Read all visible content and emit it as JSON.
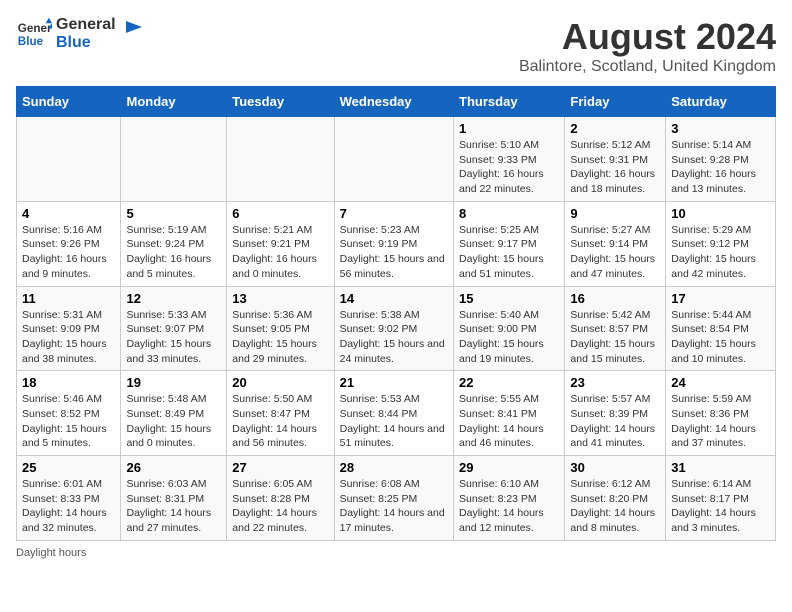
{
  "header": {
    "logo_line1": "General",
    "logo_line2": "Blue",
    "title": "August 2024",
    "subtitle": "Balintore, Scotland, United Kingdom"
  },
  "days_of_week": [
    "Sunday",
    "Monday",
    "Tuesday",
    "Wednesday",
    "Thursday",
    "Friday",
    "Saturday"
  ],
  "weeks": [
    [
      {
        "day": "",
        "sunrise": "",
        "sunset": "",
        "daylight": ""
      },
      {
        "day": "",
        "sunrise": "",
        "sunset": "",
        "daylight": ""
      },
      {
        "day": "",
        "sunrise": "",
        "sunset": "",
        "daylight": ""
      },
      {
        "day": "",
        "sunrise": "",
        "sunset": "",
        "daylight": ""
      },
      {
        "day": "1",
        "sunrise": "5:10 AM",
        "sunset": "9:33 PM",
        "daylight": "16 hours and 22 minutes."
      },
      {
        "day": "2",
        "sunrise": "5:12 AM",
        "sunset": "9:31 PM",
        "daylight": "16 hours and 18 minutes."
      },
      {
        "day": "3",
        "sunrise": "5:14 AM",
        "sunset": "9:28 PM",
        "daylight": "16 hours and 13 minutes."
      }
    ],
    [
      {
        "day": "4",
        "sunrise": "5:16 AM",
        "sunset": "9:26 PM",
        "daylight": "16 hours and 9 minutes."
      },
      {
        "day": "5",
        "sunrise": "5:19 AM",
        "sunset": "9:24 PM",
        "daylight": "16 hours and 5 minutes."
      },
      {
        "day": "6",
        "sunrise": "5:21 AM",
        "sunset": "9:21 PM",
        "daylight": "16 hours and 0 minutes."
      },
      {
        "day": "7",
        "sunrise": "5:23 AM",
        "sunset": "9:19 PM",
        "daylight": "15 hours and 56 minutes."
      },
      {
        "day": "8",
        "sunrise": "5:25 AM",
        "sunset": "9:17 PM",
        "daylight": "15 hours and 51 minutes."
      },
      {
        "day": "9",
        "sunrise": "5:27 AM",
        "sunset": "9:14 PM",
        "daylight": "15 hours and 47 minutes."
      },
      {
        "day": "10",
        "sunrise": "5:29 AM",
        "sunset": "9:12 PM",
        "daylight": "15 hours and 42 minutes."
      }
    ],
    [
      {
        "day": "11",
        "sunrise": "5:31 AM",
        "sunset": "9:09 PM",
        "daylight": "15 hours and 38 minutes."
      },
      {
        "day": "12",
        "sunrise": "5:33 AM",
        "sunset": "9:07 PM",
        "daylight": "15 hours and 33 minutes."
      },
      {
        "day": "13",
        "sunrise": "5:36 AM",
        "sunset": "9:05 PM",
        "daylight": "15 hours and 29 minutes."
      },
      {
        "day": "14",
        "sunrise": "5:38 AM",
        "sunset": "9:02 PM",
        "daylight": "15 hours and 24 minutes."
      },
      {
        "day": "15",
        "sunrise": "5:40 AM",
        "sunset": "9:00 PM",
        "daylight": "15 hours and 19 minutes."
      },
      {
        "day": "16",
        "sunrise": "5:42 AM",
        "sunset": "8:57 PM",
        "daylight": "15 hours and 15 minutes."
      },
      {
        "day": "17",
        "sunrise": "5:44 AM",
        "sunset": "8:54 PM",
        "daylight": "15 hours and 10 minutes."
      }
    ],
    [
      {
        "day": "18",
        "sunrise": "5:46 AM",
        "sunset": "8:52 PM",
        "daylight": "15 hours and 5 minutes."
      },
      {
        "day": "19",
        "sunrise": "5:48 AM",
        "sunset": "8:49 PM",
        "daylight": "15 hours and 0 minutes."
      },
      {
        "day": "20",
        "sunrise": "5:50 AM",
        "sunset": "8:47 PM",
        "daylight": "14 hours and 56 minutes."
      },
      {
        "day": "21",
        "sunrise": "5:53 AM",
        "sunset": "8:44 PM",
        "daylight": "14 hours and 51 minutes."
      },
      {
        "day": "22",
        "sunrise": "5:55 AM",
        "sunset": "8:41 PM",
        "daylight": "14 hours and 46 minutes."
      },
      {
        "day": "23",
        "sunrise": "5:57 AM",
        "sunset": "8:39 PM",
        "daylight": "14 hours and 41 minutes."
      },
      {
        "day": "24",
        "sunrise": "5:59 AM",
        "sunset": "8:36 PM",
        "daylight": "14 hours and 37 minutes."
      }
    ],
    [
      {
        "day": "25",
        "sunrise": "6:01 AM",
        "sunset": "8:33 PM",
        "daylight": "14 hours and 32 minutes."
      },
      {
        "day": "26",
        "sunrise": "6:03 AM",
        "sunset": "8:31 PM",
        "daylight": "14 hours and 27 minutes."
      },
      {
        "day": "27",
        "sunrise": "6:05 AM",
        "sunset": "8:28 PM",
        "daylight": "14 hours and 22 minutes."
      },
      {
        "day": "28",
        "sunrise": "6:08 AM",
        "sunset": "8:25 PM",
        "daylight": "14 hours and 17 minutes."
      },
      {
        "day": "29",
        "sunrise": "6:10 AM",
        "sunset": "8:23 PM",
        "daylight": "14 hours and 12 minutes."
      },
      {
        "day": "30",
        "sunrise": "6:12 AM",
        "sunset": "8:20 PM",
        "daylight": "14 hours and 8 minutes."
      },
      {
        "day": "31",
        "sunrise": "6:14 AM",
        "sunset": "8:17 PM",
        "daylight": "14 hours and 3 minutes."
      }
    ]
  ],
  "footer": {
    "daylight_label": "Daylight hours"
  }
}
